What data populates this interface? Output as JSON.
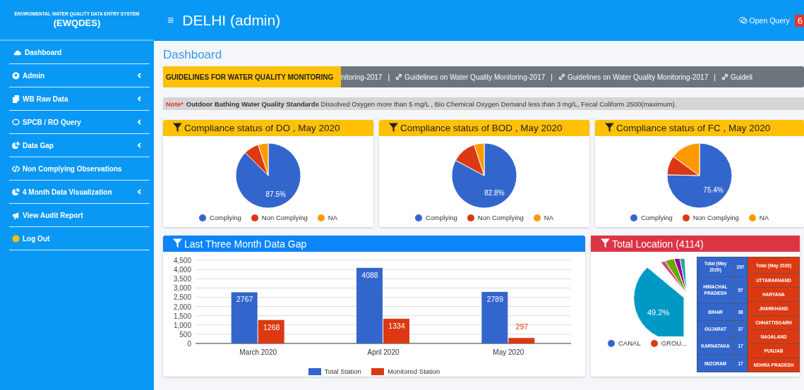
{
  "sidebar": {
    "subtitle": "ENVIROMENTAL WATER QUALITY DATA ENTRY SYSTEM",
    "title": "(EWQDES)",
    "items": [
      {
        "kind": "cloud",
        "label": "Dashboard",
        "has_submenu": false
      },
      {
        "kind": "user",
        "label": "Admin",
        "has_submenu": true
      },
      {
        "kind": "copy",
        "label": "WB Raw Data",
        "has_submenu": true
      },
      {
        "kind": "chat",
        "label": "SPCB / RO Query",
        "has_submenu": true
      },
      {
        "kind": "pie",
        "label": "Data Gap",
        "has_submenu": true
      },
      {
        "kind": "code",
        "label": "Non Complying Observations",
        "has_submenu": false
      },
      {
        "kind": "pie",
        "label": "4 Month Data Visualization",
        "has_submenu": true
      },
      {
        "kind": "bullhorn",
        "label": "View Audit Report",
        "has_submenu": false
      },
      {
        "kind": "dot",
        "label": "Log Out",
        "has_submenu": false
      }
    ]
  },
  "header": {
    "menu_glyph": "≡",
    "title": "DELHI (admin)",
    "query_label": "Open Query",
    "query_count": "6"
  },
  "page_title": "Dashboard",
  "ticker": {
    "label": "GUIDELINES FOR WATER QUALITY MONITORING",
    "separator": "|",
    "items": [
      {
        "text": "nitoring-2017",
        "link_icon": false
      },
      {
        "text": "Guidelines on Water Quality Monitoring-2017",
        "link_icon": true
      },
      {
        "text": "Guidelines on Water Quality Monitoring-2017",
        "link_icon": true
      },
      {
        "text": "Guideli",
        "link_icon": true
      }
    ]
  },
  "note": {
    "label": "Note*",
    "text": "**Outdoor Bathing Water Quality Standards** Dissolved Oxygen more than 5 mg/L , Bio Chemical Oxygen Demand less than 3 mg/L, Fecal Coliform 2500(maximum)."
  },
  "compliance_cards": [
    {
      "title": "Compliance status of DO , May 2020",
      "chart_data": {
        "type": "pie",
        "categories": [
          "Complying",
          "Non Complying",
          "NA"
        ],
        "values": [
          87.5,
          7.5,
          5.0
        ],
        "colors": [
          "#3366cc",
          "#dc3912",
          "#ff9900"
        ],
        "value_labels": [
          "87.5%",
          null,
          null
        ]
      }
    },
    {
      "title": "Compliance status of BOD , May 2020",
      "chart_data": {
        "type": "pie",
        "categories": [
          "Complying",
          "Non Complying",
          "NA"
        ],
        "values": [
          82.8,
          12.2,
          5.0
        ],
        "colors": [
          "#3366cc",
          "#dc3912",
          "#ff9900"
        ],
        "value_labels": [
          "82.8%",
          null,
          null
        ]
      }
    },
    {
      "title": "Compliance status of FC , May 2020",
      "chart_data": {
        "type": "pie",
        "categories": [
          "Complying",
          "Non Complying",
          "NA"
        ],
        "values": [
          75.4,
          9.6,
          15.0
        ],
        "colors": [
          "#3366cc",
          "#dc3912",
          "#ff9900"
        ],
        "value_labels": [
          "75.4%",
          null,
          null
        ]
      }
    }
  ],
  "data_gap_card": {
    "title": "Last Three Month Data Gap",
    "chart_data": {
      "type": "bar",
      "categories": [
        "March 2020",
        "April 2020",
        "May 2020"
      ],
      "series": [
        {
          "name": "Total Station",
          "color": "#3366cc",
          "values": [
            2767,
            4088,
            2789
          ]
        },
        {
          "name": "Monitored Station",
          "color": "#dc3912",
          "values": [
            1268,
            1334,
            297
          ]
        }
      ],
      "ylim": [
        0,
        4500
      ],
      "yticks": [
        {
          "value": 0,
          "label": "0"
        },
        {
          "value": 500,
          "label": "500"
        },
        {
          "value": 1000,
          "label": "1,000"
        },
        {
          "value": 1500,
          "label": "1,500"
        },
        {
          "value": 2000,
          "label": "2,000"
        },
        {
          "value": 2500,
          "label": "2,500"
        },
        {
          "value": 3000,
          "label": "3,000"
        },
        {
          "value": 3500,
          "label": "3,500"
        },
        {
          "value": 4000,
          "label": "4,000"
        },
        {
          "value": 4500,
          "label": "4,500"
        }
      ],
      "data_labels": true,
      "grid": true
    }
  },
  "location_card": {
    "title": "Total Location (4114)",
    "slice_label": "49.2%",
    "legend": [
      {
        "label": "CANAL",
        "color": "#3366cc"
      },
      {
        "label": "GROU...",
        "color": "#dc3912"
      }
    ],
    "tables": [
      {
        "color": "#3366cc",
        "header": [
          "Total (May 2020)",
          "297"
        ],
        "rows": [
          [
            "HIMACHAL PRADESH",
            "57"
          ],
          [
            "BIHAR",
            "38"
          ],
          [
            "GUJARAT",
            "37"
          ],
          [
            "KARNATAKA",
            "17"
          ],
          [
            "MIZORAM",
            "17"
          ]
        ]
      },
      {
        "color": "#dc3912",
        "header": [
          "Total (May 2020)"
        ],
        "rows": [
          [
            "UTTARAKHAND"
          ],
          [
            "HARYANA"
          ],
          [
            "JHARKHAND"
          ],
          [
            "CHHATTISGARH"
          ],
          [
            "NAGALAND"
          ],
          [
            "PUNJAB"
          ],
          [
            "NDHRA PRADESH"
          ]
        ]
      }
    ]
  }
}
